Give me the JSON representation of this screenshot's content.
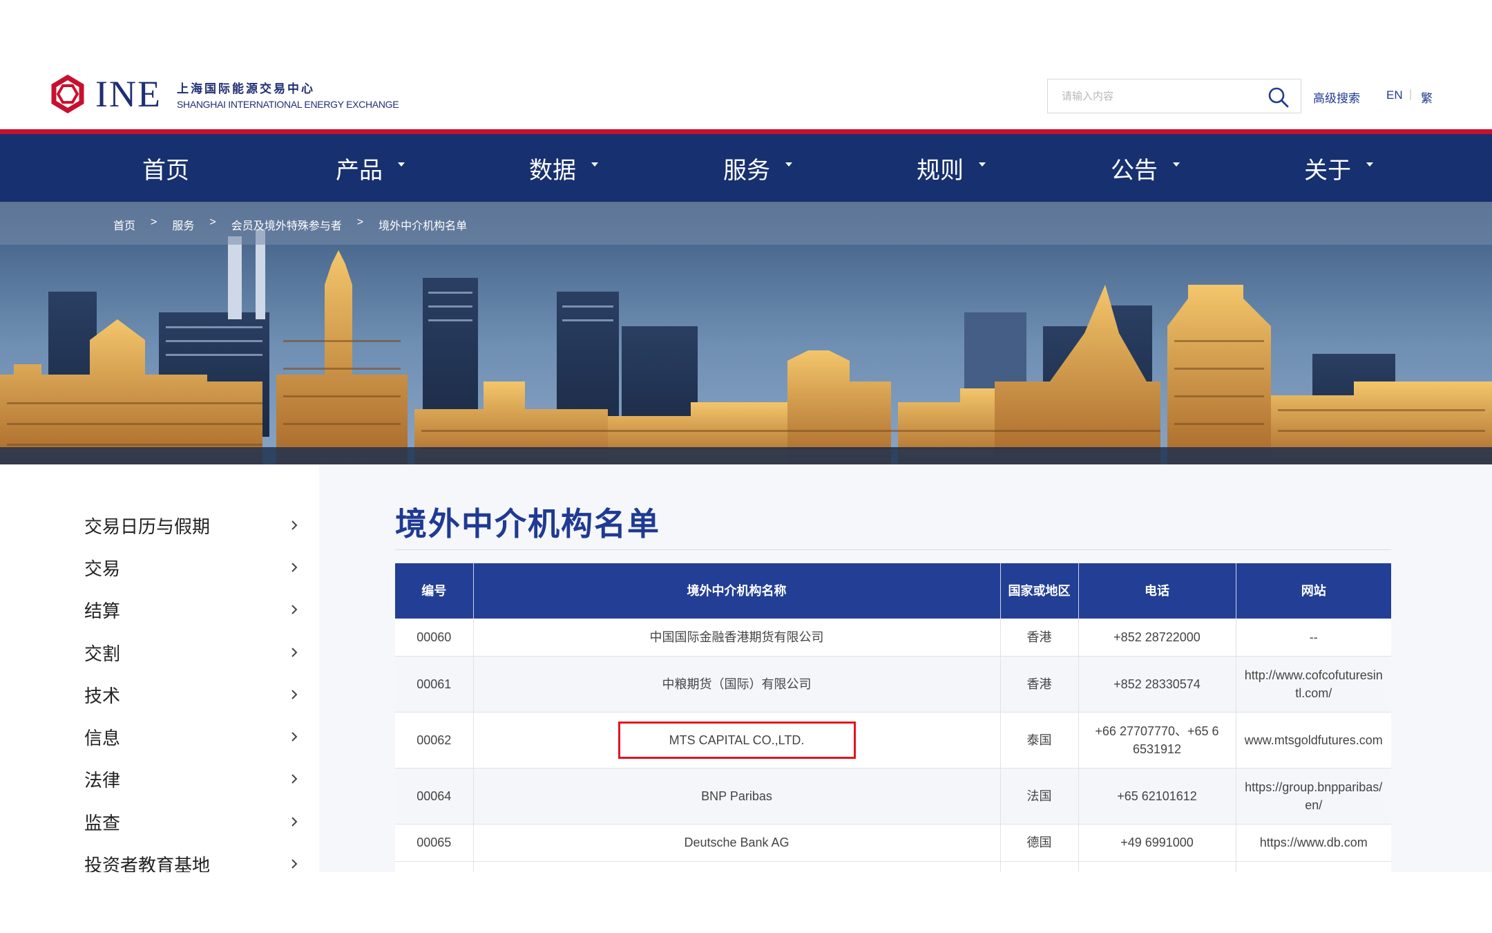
{
  "header": {
    "logo_text": "INE",
    "logo_cn": "上海国际能源交易中心",
    "logo_en": "SHANGHAI INTERNATIONAL ENERGY EXCHANGE",
    "search_placeholder": "请输入内容",
    "advanced_search": "高级搜索",
    "lang_en": "EN",
    "lang_sep": "|",
    "lang_tw": "繁"
  },
  "nav": {
    "items": [
      {
        "label": "首页",
        "has_dropdown": false
      },
      {
        "label": "产品",
        "has_dropdown": true
      },
      {
        "label": "数据",
        "has_dropdown": true
      },
      {
        "label": "服务",
        "has_dropdown": true
      },
      {
        "label": "规则",
        "has_dropdown": true
      },
      {
        "label": "公告",
        "has_dropdown": true
      },
      {
        "label": "关于",
        "has_dropdown": true
      }
    ]
  },
  "breadcrumb": {
    "items": [
      "首页",
      "服务",
      "会员及境外特殊参与者",
      "境外中介机构名单"
    ],
    "separator": ">"
  },
  "sidebar": {
    "items": [
      {
        "label": "交易日历与假期"
      },
      {
        "label": "交易"
      },
      {
        "label": "结算"
      },
      {
        "label": "交割"
      },
      {
        "label": "技术"
      },
      {
        "label": "信息"
      },
      {
        "label": "法律"
      },
      {
        "label": "监查"
      },
      {
        "label": "投资者教育基地"
      }
    ]
  },
  "main": {
    "title": "境外中介机构名单",
    "table": {
      "headers": [
        "编号",
        "境外中介机构名称",
        "国家或地区",
        "电话",
        "网站"
      ],
      "rows": [
        {
          "id": "00060",
          "name": "中国国际金融香港期货有限公司",
          "region": "香港",
          "phone": "+852 28722000",
          "site": "--"
        },
        {
          "id": "00061",
          "name": "中粮期货（国际）有限公司",
          "region": "香港",
          "phone": "+852 28330574",
          "site": "http://www.cofcofuturesintl.com/"
        },
        {
          "id": "00062",
          "name": "MTS CAPITAL CO.,LTD.",
          "region": "泰国",
          "phone": "+66 27707770、+65 6 6531912",
          "site": "www.mtsgoldfutures.com"
        },
        {
          "id": "00064",
          "name": "BNP Paribas",
          "region": "法国",
          "phone": "+65 62101612",
          "site": "https://group.bnpparibas/en/"
        },
        {
          "id": "00065",
          "name": "Deutsche Bank AG",
          "region": "德国",
          "phone": "+49 6991000",
          "site": "https://www.db.com"
        }
      ],
      "highlighted_row_id": "00062"
    }
  },
  "colors": {
    "brand_navy": "#17306f",
    "table_header": "#233f95",
    "accent_red": "#c8102e",
    "highlight_red": "#e5131e"
  }
}
